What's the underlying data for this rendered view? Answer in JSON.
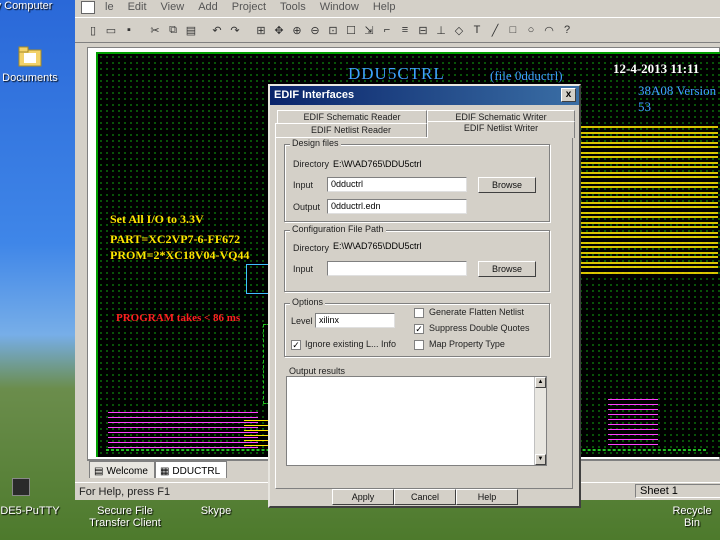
{
  "desktop": {
    "icons": [
      {
        "label": "y Computer"
      },
      {
        "label": "Documents"
      }
    ],
    "taskbar_items": [
      {
        "label": "DE5-PuTTY"
      },
      {
        "label": "Secure File\nTransfer Client"
      },
      {
        "label": "Skype"
      },
      {
        "label": "Recycle Bin"
      }
    ]
  },
  "app": {
    "menu": [
      "le",
      "Edit",
      "View",
      "Add",
      "Project",
      "Tools",
      "Window",
      "Help"
    ],
    "schematic": {
      "title": "DDU5CTRL",
      "file": "(file 0dductrl)",
      "date": "12-4-2013   11:11",
      "revision": "38A08    Version 53",
      "voltage": "Set All I/O to 3.3V",
      "part": "PART=XC2VP7-6-FF672",
      "prom": "PROM=2*XC18V04-VQ44",
      "program": "PROGRAM takes < 86 ms"
    },
    "tabs": [
      {
        "label": "Welcome"
      },
      {
        "label": "DDUCTRL"
      }
    ],
    "status_left": "For Help, press F1",
    "status_sheet": "Sheet 1"
  },
  "dialog": {
    "title": "EDIF Interfaces",
    "close": "x",
    "tabs_back": [
      "EDIF Schematic Reader",
      "EDIF Schematic Writer"
    ],
    "tabs_front": [
      "EDIF Netlist Reader",
      "EDIF Netlist Writer"
    ],
    "design_files": {
      "label": "Design files",
      "directory_label": "Directory",
      "directory_value": "E:\\W\\AD765\\DDU5ctrl",
      "input_label": "Input",
      "input_value": "0dductrl",
      "output_label": "Output",
      "output_value": "0dductrl.edn",
      "browse": "Browse"
    },
    "config_file": {
      "label": "Configuration File Path",
      "directory_label": "Directory",
      "directory_value": "E:\\W\\AD765\\DDU5ctrl",
      "input_label": "Input",
      "input_value": "",
      "browse": "Browse"
    },
    "options": {
      "label": "Options",
      "level_label": "Level",
      "level_value": "xilinx",
      "ignore_label": "Ignore existing L... Info",
      "flatten_label": "Generate Flatten Netlist",
      "suppress_label": "Suppress Double Quotes",
      "map_label": "Map Property Type"
    },
    "output_results_label": "Output results",
    "buttons": {
      "apply": "Apply",
      "cancel": "Cancel",
      "help": "Help"
    }
  },
  "colors": {
    "schematic_bg": "#000000",
    "title_blue": "#3fa0ff",
    "label_yellow": "#ffe400",
    "warning_red": "#ff2020",
    "dialog_title": "#0a246a"
  }
}
